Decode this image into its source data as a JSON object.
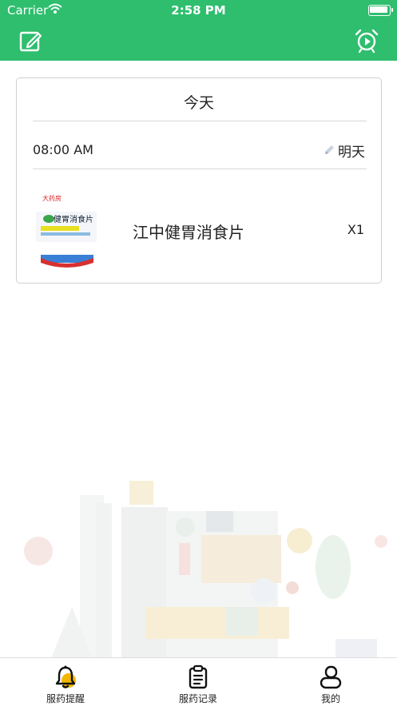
{
  "status_bar": {
    "carrier": "Carrier",
    "time": "2:58 PM"
  },
  "nav": {
    "left_icon": "edit-icon",
    "right_icon": "alarm-clock-icon"
  },
  "card": {
    "title": "今天",
    "time": "08:00 AM",
    "tomorrow_label": "明天",
    "medicine": {
      "name": "江中健胃消食片",
      "quantity": "X1",
      "image_label_brand": "大药房",
      "image_label_name": "健胃消食片"
    }
  },
  "tabs": [
    {
      "label": "服药提醒",
      "icon": "bell-icon"
    },
    {
      "label": "服药记录",
      "icon": "clipboard-icon"
    },
    {
      "label": "我的",
      "icon": "user-icon"
    }
  ],
  "colors": {
    "brand": "#2ebe6e",
    "alert": "#f2b705"
  }
}
